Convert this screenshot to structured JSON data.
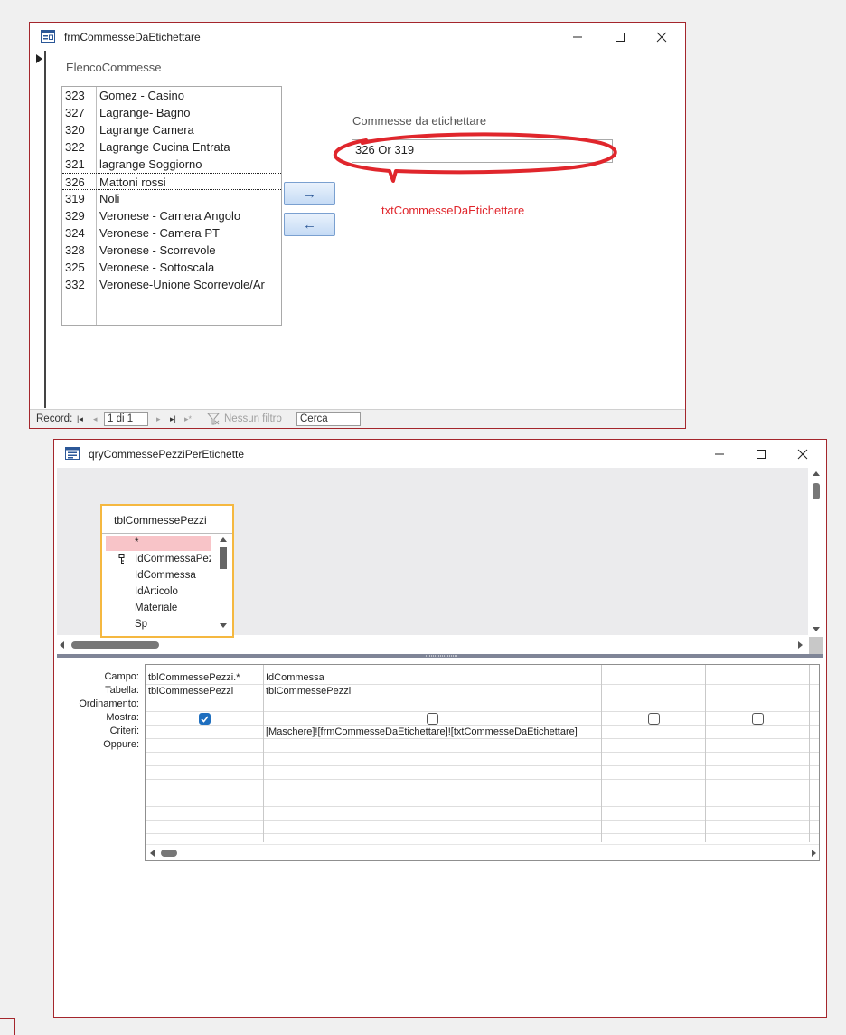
{
  "form_window": {
    "title": "frmCommesseDaEtichettare",
    "list_label": "ElencoCommesse",
    "list_items": [
      {
        "id": "323",
        "name": "Gomez - Casino"
      },
      {
        "id": "327",
        "name": "Lagrange- Bagno"
      },
      {
        "id": "320",
        "name": "Lagrange Camera"
      },
      {
        "id": "322",
        "name": "Lagrange Cucina Entrata"
      },
      {
        "id": "321",
        "name": "lagrange Soggiorno"
      },
      {
        "id": "326",
        "name": "Mattoni rossi"
      },
      {
        "id": "319",
        "name": "Noli"
      },
      {
        "id": "329",
        "name": "Veronese - Camera Angolo"
      },
      {
        "id": "324",
        "name": "Veronese - Camera PT"
      },
      {
        "id": "328",
        "name": "Veronese - Scorrevole"
      },
      {
        "id": "325",
        "name": "Veronese - Sottoscala"
      },
      {
        "id": "332",
        "name": "Veronese-Unione Scorrevole/Ar"
      }
    ],
    "add_button": "→",
    "remove_button": "←",
    "textbox_label": "Commesse da etichettare",
    "textbox_value": "326 Or 319",
    "annotation": "txtCommesseDaEtichettare",
    "navbar": {
      "record_label": "Record:",
      "first": "|◂",
      "prev": "◂",
      "position": "1 di 1",
      "next": "▸",
      "last": "▸|",
      "new": "▸*",
      "filter": "Nessun filtro",
      "search": "Cerca"
    }
  },
  "query_window": {
    "title": "qryCommessePezziPerEtichette",
    "table": {
      "name": "tblCommessePezzi",
      "fields": [
        "*",
        "IdCommessaPezz",
        "IdCommessa",
        "IdArticolo",
        "Materiale",
        "Sp"
      ]
    },
    "row_labels": [
      "Campo:",
      "Tabella:",
      "Ordinamento:",
      "Mostra:",
      "Criteri:",
      "Oppure:"
    ],
    "columns": [
      {
        "campo": "tblCommessePezzi.*",
        "tabella": "tblCommessePezzi",
        "mostra": true,
        "criteri": ""
      },
      {
        "campo": "IdCommessa",
        "tabella": "tblCommessePezzi",
        "mostra": false,
        "criteri": "[Maschere]![frmCommesseDaEtichettare]![txtCommesseDaEtichettare]"
      },
      {
        "campo": "",
        "tabella": "",
        "mostra": false,
        "criteri": ""
      },
      {
        "campo": "",
        "tabella": "",
        "mostra": false,
        "criteri": ""
      }
    ]
  },
  "colors": {
    "window_border": "#a4262c",
    "annotation_red": "#e0262c",
    "table_highlight": "#f5b840",
    "check_blue": "#1f6fbf"
  }
}
